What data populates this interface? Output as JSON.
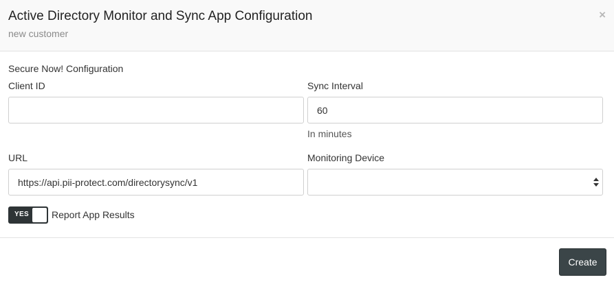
{
  "modal": {
    "title": "Active Directory Monitor and Sync App Configuration",
    "subtitle": "new customer",
    "close_icon": "close-icon",
    "close_glyph": "×"
  },
  "form": {
    "section_label": "Secure Now! Configuration",
    "client_id": {
      "label": "Client ID",
      "value": "",
      "placeholder": ""
    },
    "sync_interval": {
      "label": "Sync Interval",
      "value": "60",
      "help": "In minutes"
    },
    "url": {
      "label": "URL",
      "value": "https://api.pii-protect.com/directorysync/v1"
    },
    "monitoring_device": {
      "label": "Monitoring Device",
      "selected": ""
    },
    "report_toggle": {
      "state_label": "YES",
      "label": "Report App Results",
      "on": true
    }
  },
  "footer": {
    "create_label": "Create"
  },
  "colors": {
    "toggle_bg": "#2e3436",
    "button_bg": "#3b4548",
    "header_bg": "#f9f9f9"
  }
}
